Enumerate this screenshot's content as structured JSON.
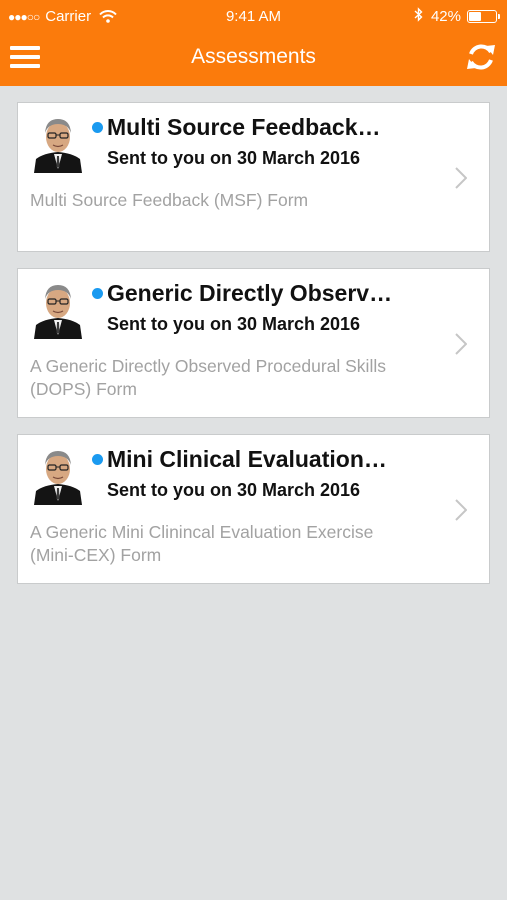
{
  "status_bar": {
    "carrier": "Carrier",
    "time": "9:41 AM",
    "battery": "42%",
    "battery_level": 0.42
  },
  "header": {
    "title": "Assessments",
    "background": "#fb7b0c",
    "menu_icon": "hamburger-menu-icon",
    "refresh_icon": "refresh-icon"
  },
  "assessments": [
    {
      "title": "Multi Source Feedback…",
      "subtitle": "Sent to you on 30 March 2016",
      "description": "Multi Source Feedback (MSF) Form",
      "unread": true
    },
    {
      "title": "Generic Directly Observ…",
      "subtitle": "Sent to you on 30 March 2016",
      "description": "A Generic Directly Observed Procedural Skills (DOPS) Form",
      "unread": true
    },
    {
      "title": "Mini Clinical Evaluation…",
      "subtitle": "Sent to you on 30 March 2016",
      "description": "A Generic Mini Clinincal Evaluation Exercise (Mini-CEX) Form",
      "unread": true
    }
  ],
  "colors": {
    "unread_dot": "#1a9af0",
    "background": "#dfe1e2"
  }
}
